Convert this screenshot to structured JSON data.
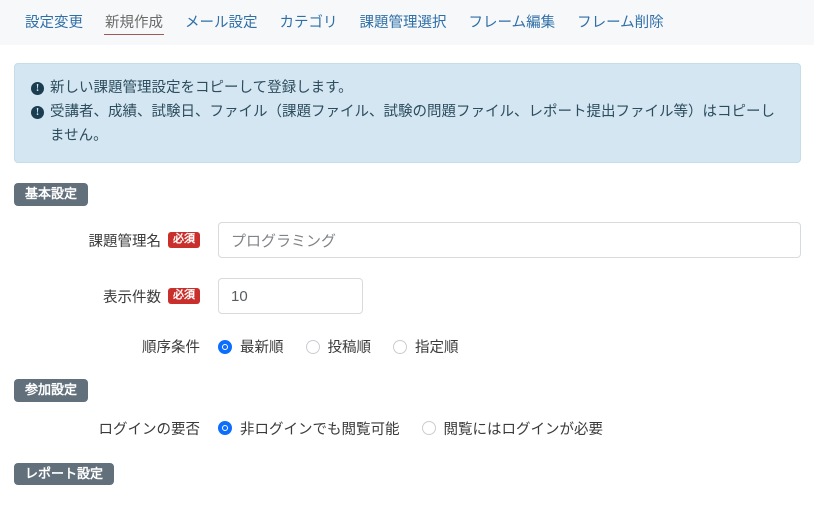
{
  "nav": {
    "items": [
      {
        "label": "設定変更",
        "active": false
      },
      {
        "label": "新規作成",
        "active": true
      },
      {
        "label": "メール設定",
        "active": false
      },
      {
        "label": "カテゴリ",
        "active": false
      },
      {
        "label": "課題管理選択",
        "active": false
      },
      {
        "label": "フレーム編集",
        "active": false
      },
      {
        "label": "フレーム削除",
        "active": false
      }
    ]
  },
  "alert": {
    "icon": "exclamation-circle-icon",
    "lines": [
      "新しい課題管理設定をコピーして登録します。",
      "受講者、成績、試験日、ファイル（課題ファイル、試験の問題ファイル、レポート提出ファイル等）はコピーしません。"
    ]
  },
  "sections": {
    "basic": {
      "title": "基本設定"
    },
    "join": {
      "title": "参加設定"
    },
    "report": {
      "title": "レポート設定"
    }
  },
  "fields": {
    "assignment_name": {
      "label": "課題管理名",
      "required_badge": "必須",
      "value": "プログラミング",
      "placeholder": "プログラミング"
    },
    "display_count": {
      "label": "表示件数",
      "required_badge": "必須",
      "value": "10",
      "placeholder": "10"
    },
    "order_condition": {
      "label": "順序条件",
      "options": [
        {
          "label": "最新順",
          "checked": true
        },
        {
          "label": "投稿順",
          "checked": false
        },
        {
          "label": "指定順",
          "checked": false
        }
      ]
    },
    "login_requirement": {
      "label": "ログインの要否",
      "options": [
        {
          "label": "非ログインでも閲覧可能",
          "checked": true
        },
        {
          "label": "閲覧にはログインが必要",
          "checked": false
        }
      ]
    }
  },
  "colors": {
    "nav_link": "#2f6fa8",
    "nav_active_underline": "#9c5a59",
    "alert_bg": "#d4e6f1",
    "section_badge_bg": "#62707c",
    "required_badge_bg": "#c9302c",
    "radio_checked": "#0d6efd"
  }
}
